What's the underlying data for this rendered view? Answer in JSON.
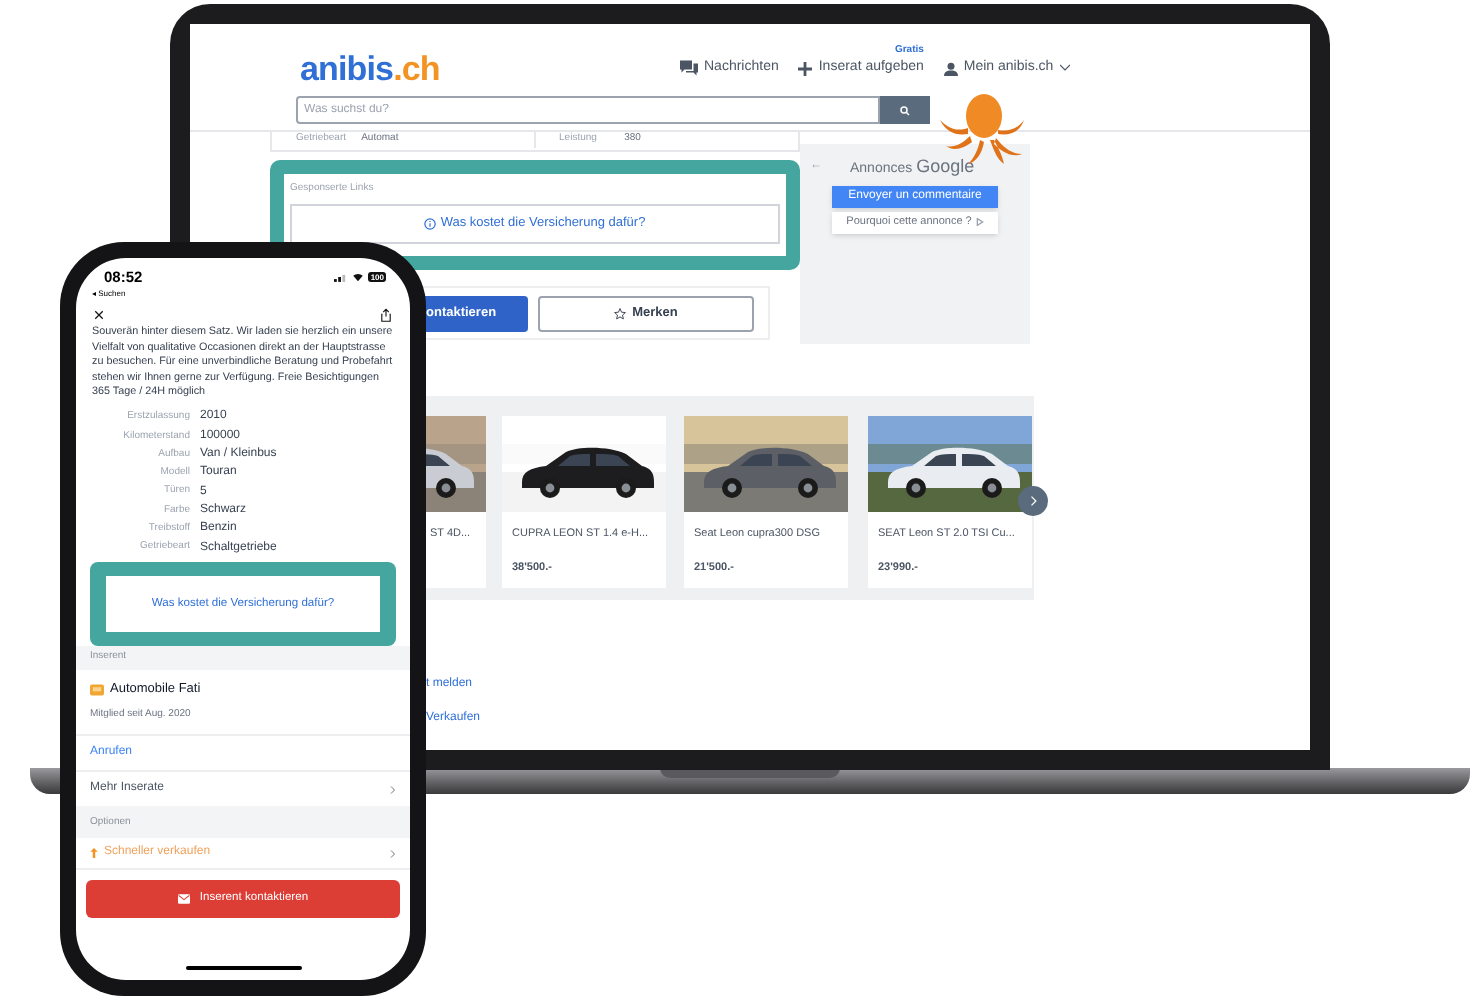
{
  "laptop": {
    "header": {
      "logo": {
        "name": "anibis",
        "tld": ".ch"
      },
      "nav": [
        {
          "kind": "messages",
          "label": "Nachrichten"
        },
        {
          "kind": "post",
          "label": "Inserat aufgeben",
          "badge": "Gratis"
        },
        {
          "kind": "account",
          "label": "Mein anibis.ch"
        }
      ]
    },
    "search": {
      "placeholder": "Was suchst du?"
    },
    "spec_row": [
      "Getriebeart",
      "Automat",
      "Leistung",
      "380"
    ],
    "sponsored": {
      "label": "Gesponserte Links",
      "link": "Was kostet die Versicherung dafür?"
    },
    "buttons": [
      {
        "kind": "primary",
        "label": "ontaktieren"
      },
      {
        "kind": "secondary",
        "label": "Merken"
      }
    ],
    "ad_panel": {
      "back": "←",
      "title": "Annonces",
      "brand": "Google",
      "feedback": "Envoyer un commentaire",
      "why": "Pourquoi cette annonce ?"
    },
    "listings": [
      {
        "title": "ST 4D..."
      },
      {
        "title": "CUPRA LEON ST 1.4 e-H...",
        "price": "38'500.-"
      },
      {
        "title": "Seat Leon cupra300 DSG",
        "price": "21'500.-"
      },
      {
        "title": "SEAT Leon ST 2.0 TSI Cu...",
        "price": "23'990.-"
      }
    ],
    "links": [
      "t melden",
      "Verkaufen"
    ]
  },
  "phone": {
    "status": {
      "time": "08:52",
      "back": "◂ Suchen",
      "battery": "100"
    },
    "description": "Souverän hinter diesem Satz. Wir laden sie herzlich ein unsere Vielfalt von qualitative Occasionen direkt an der Hauptstrasse zu besuchen. Für eine unverbindliche Beratung und Probefahrt stehen wir Ihnen gerne zur Verfügung. Freie Besichtigungen 365 Tage / 24H möglich",
    "specs": [
      {
        "label": "Erstzulassung",
        "value": "2010"
      },
      {
        "label": "Kilometerstand",
        "value": "100000"
      },
      {
        "label": "Aufbau",
        "value": "Van / Kleinbus"
      },
      {
        "label": "Modell",
        "value": "Touran"
      },
      {
        "label": "Türen",
        "value": "5"
      },
      {
        "label": "Farbe",
        "value": "Schwarz"
      },
      {
        "label": "Treibstoff",
        "value": "Benzin"
      },
      {
        "label": "Getriebeart",
        "value": "Schaltgetriebe"
      }
    ],
    "sponsored_link": "Was kostet die Versicherung dafür?",
    "seller_section": "Inserent",
    "seller": {
      "name": "Automobile Fati",
      "since": "Mitglied seit Aug. 2020"
    },
    "call": "Anrufen",
    "more": "Mehr Inserate",
    "options_section": "Optionen",
    "sell_faster": "Schneller verkaufen",
    "contact_button": "Inserent kontaktieren"
  }
}
